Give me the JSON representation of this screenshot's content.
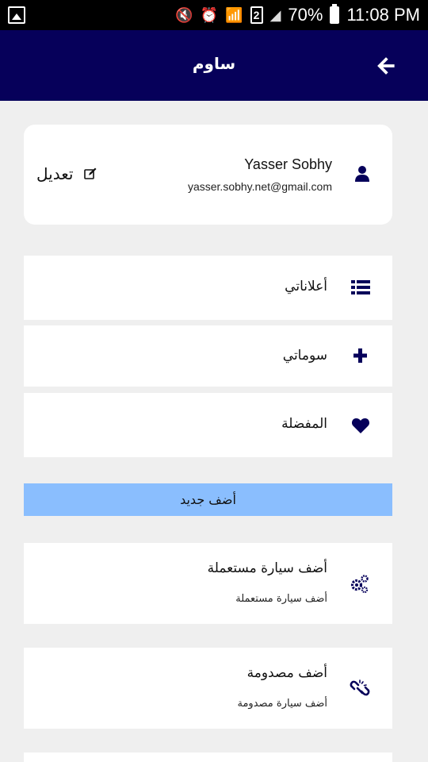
{
  "status_bar": {
    "battery": "70%",
    "time": "11:08 PM",
    "sim_slot": "2"
  },
  "app_bar": {
    "title": "ساوم",
    "back_icon": "arrow-left-icon"
  },
  "profile": {
    "name": "Yasser Sobhy",
    "email": "yasser.sobhy.net@gmail.com",
    "edit_label": "تعديل",
    "user_icon": "user-icon",
    "edit_icon": "edit-icon"
  },
  "menu": [
    {
      "label": "أعلاناتي",
      "icon": "list-icon"
    },
    {
      "label": "سوماتي",
      "icon": "plus-icon"
    },
    {
      "label": "المفضلة",
      "icon": "heart-icon"
    }
  ],
  "add_new": {
    "label": "أضف جديد"
  },
  "add_items": [
    {
      "title": "أضف سيارة مستعملة",
      "subtitle": "أضف سيارة مستعملة",
      "icon": "gears-icon"
    },
    {
      "title": "أضف مصدومة",
      "subtitle": "أضف سيارة مصدومة",
      "icon": "broken-link-icon"
    }
  ],
  "colors": {
    "app_bar": "#06005a",
    "accent_icon": "#06005a",
    "add_new_bar": "#8abefe",
    "background": "#efefef"
  }
}
